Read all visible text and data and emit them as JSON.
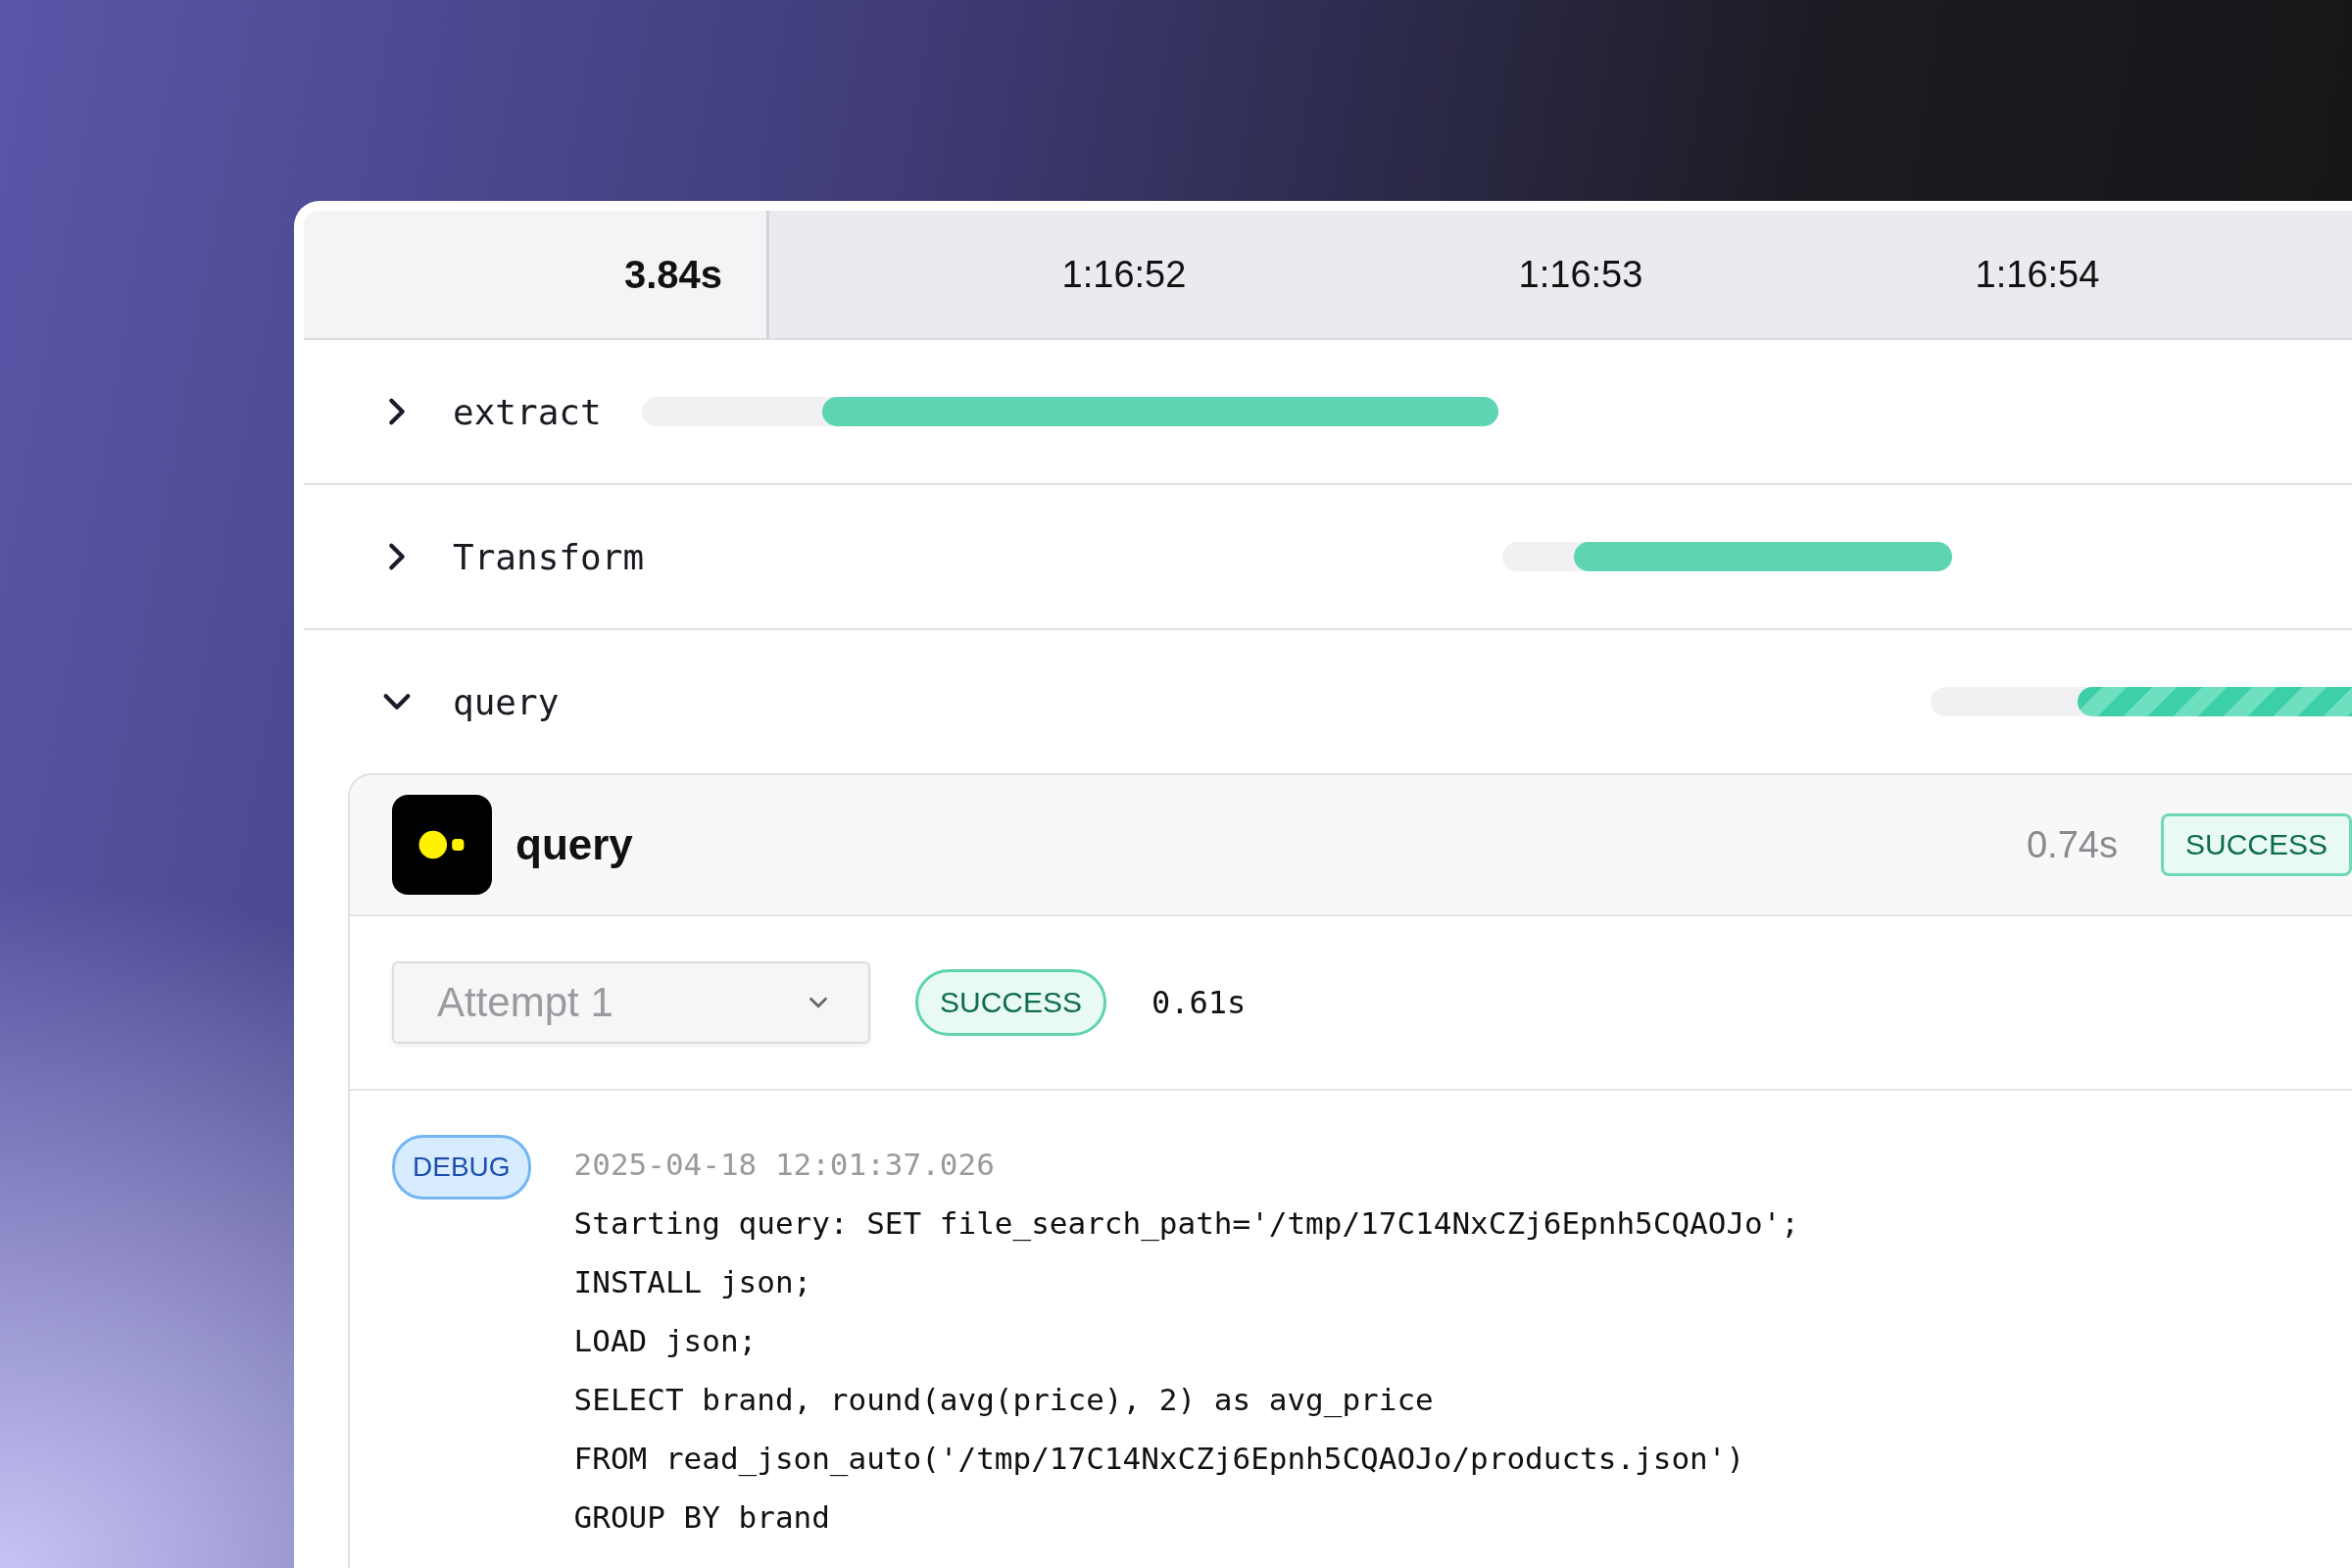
{
  "timeline_header": {
    "duration": "3.84s",
    "ticks": [
      "1:16:52",
      "1:16:53",
      "1:16:54"
    ]
  },
  "tasks": [
    {
      "name": "extract",
      "expanded": false,
      "level": 0.79,
      "running": false
    },
    {
      "name": "Transform",
      "expanded": false,
      "level": 0.84,
      "running": false
    },
    {
      "name": "query",
      "expanded": true,
      "level": 0.75,
      "running": true
    }
  ],
  "detail": {
    "title": "query",
    "duration": "0.74s",
    "status": "SUCCESS",
    "attempt": {
      "value": "Attempt 1",
      "status": "SUCCESS",
      "duration": "0.61s"
    },
    "logs": [
      {
        "level": "DEBUG",
        "timestamp": "2025-04-18 12:01:37.026",
        "lines": [
          "Starting query: SET file_search_path='/tmp/17C14NxCZj6Epnh5CQAOJo';",
          "INSTALL json;",
          "LOAD json;",
          "SELECT brand, round(avg(price), 2) as avg_price",
          "FROM read_json_auto('/tmp/17C14NxCZj6Epnh5CQAOJo/products.json')",
          "GROUP BY brand"
        ]
      }
    ]
  }
}
